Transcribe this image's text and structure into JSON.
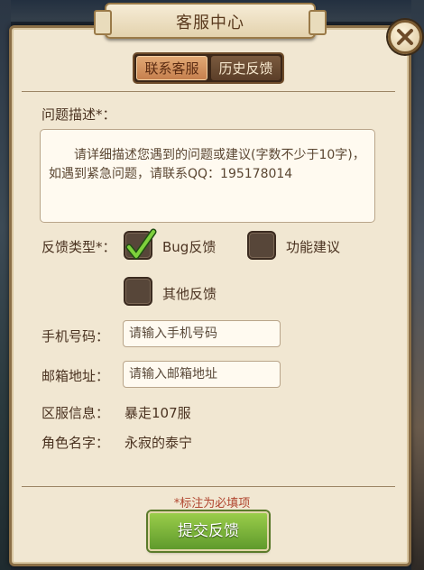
{
  "window": {
    "title": "客服中心"
  },
  "tabs": [
    {
      "label": "联系客服",
      "active": true
    },
    {
      "label": "历史反馈",
      "active": false
    }
  ],
  "form": {
    "description_label": "问题描述*：",
    "description_text": "请详细描述您遇到的问题或建议(字数不少于10字)，如遇到紧急问题，请联系QQ：195178014",
    "feedback_type_label": "反馈类型*：",
    "feedback_options": [
      {
        "label": "Bug反馈",
        "checked": true
      },
      {
        "label": "功能建议",
        "checked": false
      },
      {
        "label": "其他反馈",
        "checked": false
      }
    ],
    "phone_label": "手机号码：",
    "phone_placeholder": "请输入手机号码",
    "email_label": "邮箱地址：",
    "email_placeholder": "请输入邮箱地址",
    "server_label": "区服信息：",
    "server_value": "暴走107服",
    "role_label": "角色名字：",
    "role_value": "永寂的泰宁",
    "required_note": "*标注为必填项",
    "submit_label": "提交反馈"
  },
  "icons": {
    "close": "close-icon",
    "check": "checkmark-icon"
  },
  "colors": {
    "panel_bg": "#f1e7d2",
    "accent_green": "#6fa935",
    "required_red": "#b0452f",
    "text_brown": "#4a3220"
  }
}
